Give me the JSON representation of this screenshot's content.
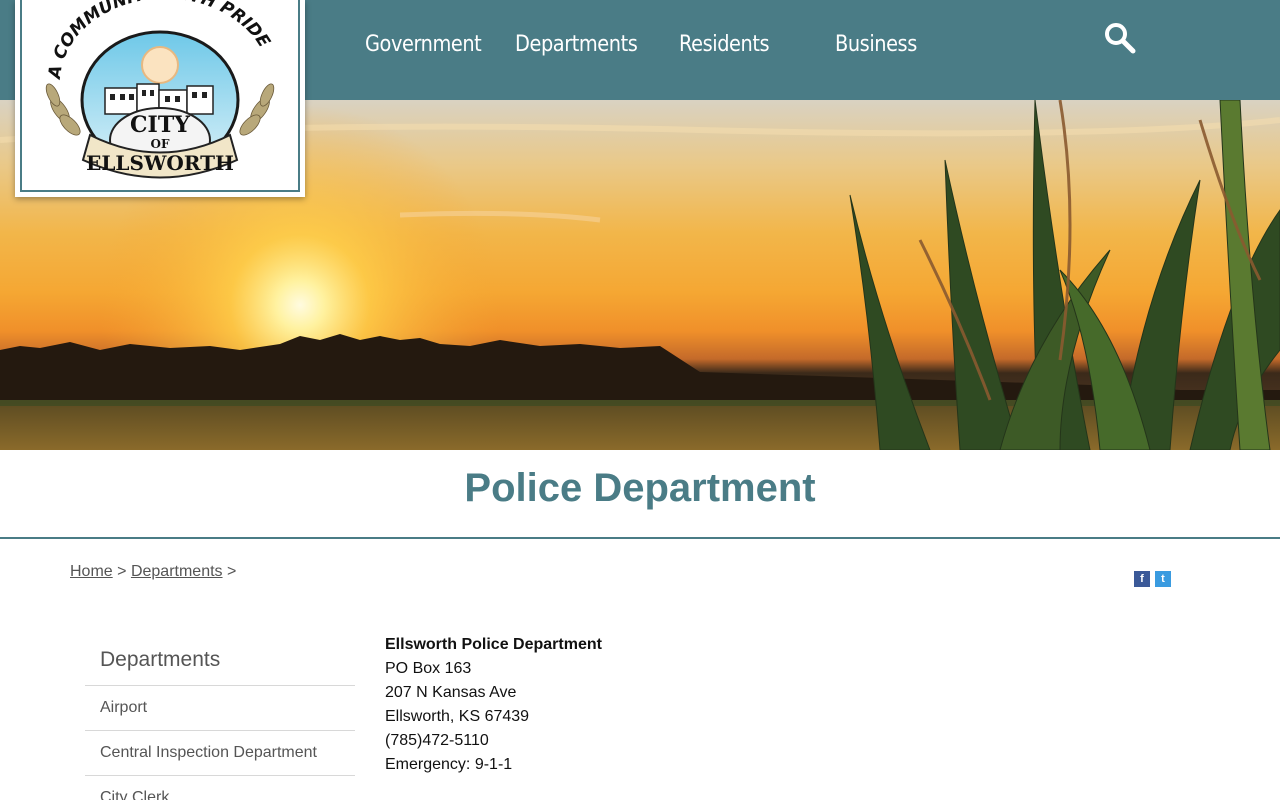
{
  "logo": {
    "arc_text": "A COMMUNITY WITH PRIDE",
    "city_text": "CITY",
    "of_text": "OF",
    "name_text": "ELLSWORTH"
  },
  "nav": {
    "items": [
      "Government",
      "Departments",
      "Residents",
      "Business"
    ],
    "search_icon": "search-icon"
  },
  "page": {
    "title": "Police Department"
  },
  "breadcrumb": {
    "home": "Home",
    "sep1": ">",
    "departments": "Departments",
    "sep2": ">"
  },
  "social": {
    "facebook_icon": "facebook-icon",
    "facebook_glyph": "f",
    "twitter_icon": "twitter-icon",
    "twitter_glyph": "t"
  },
  "sidebar": {
    "title": "Departments",
    "items": [
      "Airport",
      "Central Inspection Department",
      "City Clerk"
    ]
  },
  "content": {
    "name": "Ellsworth Police Department",
    "po_box": "PO Box 163",
    "street": "207 N Kansas Ave",
    "city_state_zip": "Ellsworth, KS 67439",
    "phone": "(785)472-5110",
    "emergency": "Emergency:  9-1-1"
  },
  "colors": {
    "brand_teal": "#4a7c86",
    "text_gray": "#555555"
  }
}
